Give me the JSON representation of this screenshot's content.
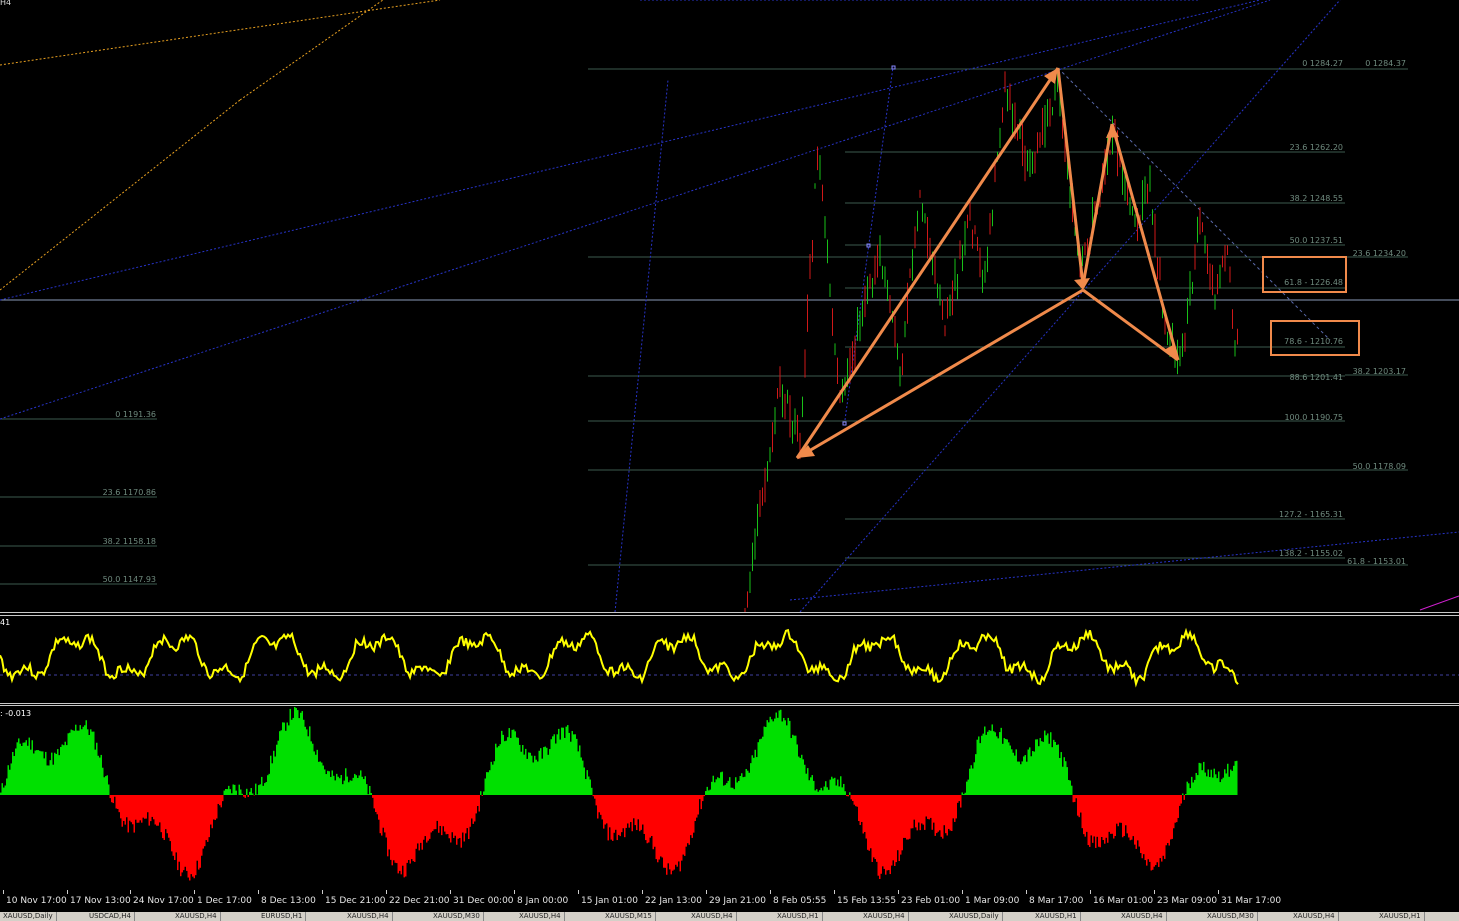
{
  "colors": {
    "background": "#000000",
    "fib_line": "#3c5a4e",
    "fib_text": "#6f8a7e",
    "trend_blue": "#2733c8",
    "pattern_orange": "#f08a4b",
    "highlight_orange": "#f08a4b",
    "candle_up": "#18c018",
    "candle_down": "#d01818",
    "osc_line": "#ffff00",
    "hist_up": "#00e000",
    "hist_down": "#ff0000",
    "price_line": "#8a9ab8",
    "diag_orange": "#e8a020",
    "magenta": "#d020d0"
  },
  "main_chart": {
    "corner_label": "H4",
    "fib_right": [
      "0 1284.27",
      "23.6 1262.20",
      "38.2 1248.55",
      "50.0 1237.51",
      "61.8 - 1226.48",
      "78.6 - 1210.76",
      "88.6 1201.41",
      "100.0 1190.75",
      "127.2 - 1165.31",
      "138.2 - 1155.02"
    ],
    "fib_far_right": [
      "0 1284.37",
      "23.6 1234.20",
      "38.2 1203.17",
      "50.0 1178.09",
      "61.8 - 1153.01"
    ],
    "fib_left": [
      "0 1191.36",
      "23.6 1170.86",
      "38.2 1158.18",
      "50.0 1147.93"
    ]
  },
  "oscillator": {
    "label": "41"
  },
  "histogram": {
    "label": "-0.013"
  },
  "time_axis": [
    "10 Nov 17:00",
    "17 Nov 13:00",
    "24 Nov 17:00",
    "1 Dec 17:00",
    "8 Dec 13:00",
    "15 Dec 21:00",
    "22 Dec 21:00",
    "31 Dec 00:00",
    "8 Jan 00:00",
    "15 Jan 01:00",
    "22 Jan 13:00",
    "29 Jan 21:00",
    "8 Feb 05:55",
    "15 Feb 13:55",
    "23 Feb 01:00",
    "1 Mar 09:00",
    "8 Mar 17:00",
    "16 Mar 01:00",
    "23 Mar 09:00",
    "31 Mar 17:00"
  ],
  "tabs": [
    "XAUUSD,Daily",
    "USDCAD,H4",
    "XAUUSD,H4",
    "EURUSD,H1",
    "XAUUSD,H4",
    "XAUUSD,M30",
    "XAUUSD,H4",
    "XAUUSD,M15",
    "XAUUSD,H4",
    "XAUUSD,H1",
    "XAUUSD,H4",
    "XAUUSD,Daily",
    "XAUUSD,H1",
    "XAUUSD,H4",
    "XAUUSD,M30",
    "XAUUSD,H4",
    "XAUUSD,H1"
  ]
}
